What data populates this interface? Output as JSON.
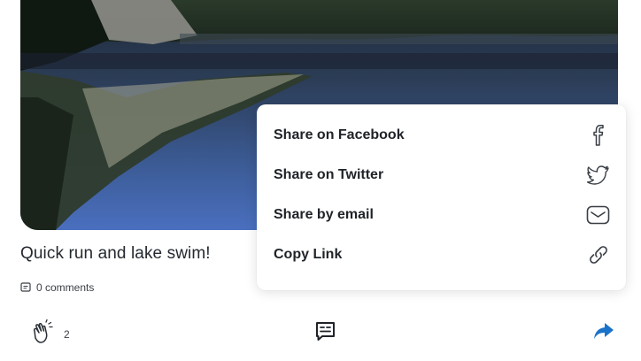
{
  "post": {
    "title": "Quick run and lake swim!",
    "comments_label": "0 comments"
  },
  "actions": {
    "clap_count": "2"
  },
  "share_menu": {
    "items": [
      {
        "label": "Share on Facebook",
        "icon": "facebook-icon"
      },
      {
        "label": "Share on Twitter",
        "icon": "twitter-icon"
      },
      {
        "label": "Share by email",
        "icon": "email-icon"
      },
      {
        "label": "Copy Link",
        "icon": "link-icon"
      }
    ]
  },
  "colors": {
    "share_accent": "#1a73c9",
    "text": "#1f2328",
    "icon": "#3a3f45"
  }
}
